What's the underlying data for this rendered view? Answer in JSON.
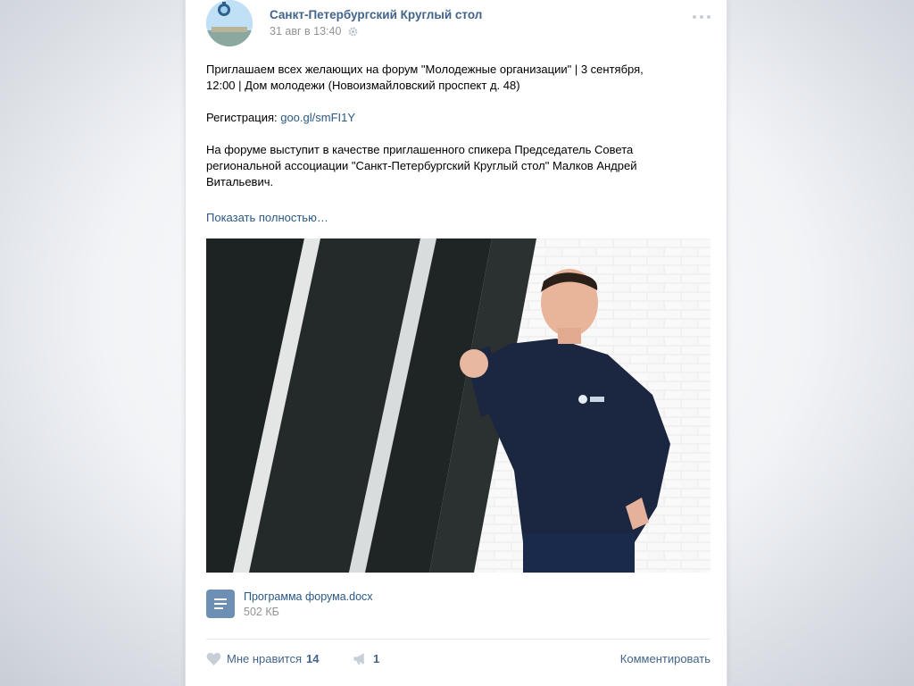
{
  "post": {
    "group_name": "Санкт-Петербургский Круглый стол",
    "date": "31 авг в 13:40",
    "text": {
      "line1": "Приглашаем всех желающих на форум \"Молодежные организации\" | 3 сентября,",
      "line2": "12:00 | Дом молодежи (Новоизмайловский проспект д. 48)",
      "reg_label": "Регистрация: ",
      "reg_link": "goo.gl/smFI1Y",
      "para3": "На форуме выступит в качестве приглашенного спикера Председатель Совета региональной ассоциации \"Санкт-Петербургский Круглый стол\" Малков Андрей Витальевич."
    },
    "show_more": "Показать полностью…",
    "attachment": {
      "name": "Программа форума.docx",
      "size": "502 КБ"
    },
    "actions": {
      "like_label": "Мне нравится",
      "like_count": "14",
      "share_count": "1",
      "comment_label": "Комментировать"
    }
  },
  "icons": {
    "settings": "gear-icon",
    "more": "more-dots-icon",
    "document": "document-icon",
    "like": "heart-icon",
    "share": "megaphone-icon"
  },
  "colors": {
    "link": "#2a5885",
    "name": "#42648b",
    "meta": "#939393",
    "doc_icon": "#6d8fb4"
  }
}
